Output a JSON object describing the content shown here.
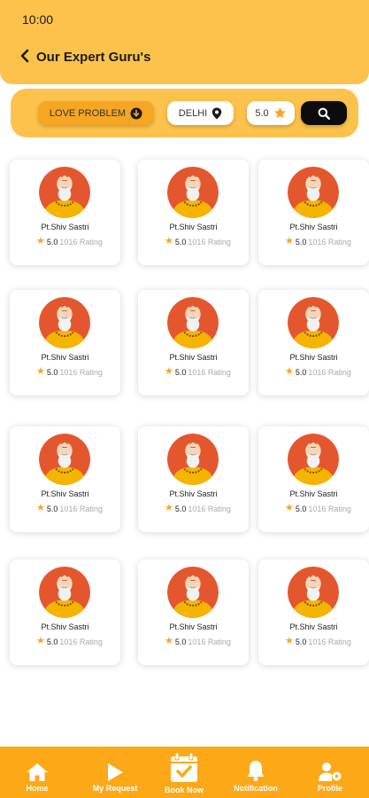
{
  "status_bar": {
    "time": "10:00"
  },
  "header": {
    "title": "Our Expert Guru's"
  },
  "filters": {
    "category": "LOVE PROBLEM",
    "location": "DELHI",
    "rating": "5.0"
  },
  "gurus": [
    {
      "name": "Pt.Shiv Sastri",
      "rating": "5.0",
      "rating_count": "1016 Rating"
    },
    {
      "name": "Pt.Shiv Sastri",
      "rating": "5.0",
      "rating_count": "1016 Rating"
    },
    {
      "name": "Pt.Shiv Sastri",
      "rating": "5.0",
      "rating_count": "1016 Rating"
    },
    {
      "name": "Pt.Shiv Sastri",
      "rating": "5.0",
      "rating_count": "1016 Rating"
    },
    {
      "name": "Pt.Shiv Sastri",
      "rating": "5.0",
      "rating_count": "1016 Rating"
    },
    {
      "name": "Pt.Shiv Sastri",
      "rating": "5.0",
      "rating_count": "1016 Rating"
    },
    {
      "name": "Pt.Shiv Sastri",
      "rating": "5.0",
      "rating_count": "1016 Rating"
    },
    {
      "name": "Pt.Shiv Sastri",
      "rating": "5.0",
      "rating_count": "1016 Rating"
    },
    {
      "name": "Pt.Shiv Sastri",
      "rating": "5.0",
      "rating_count": "1016 Rating"
    },
    {
      "name": "Pt.Shiv Sastri",
      "rating": "5.0",
      "rating_count": "1016 Rating"
    },
    {
      "name": "Pt.Shiv Sastri",
      "rating": "5.0",
      "rating_count": "1016 Rating"
    },
    {
      "name": "Pt.Shiv Sastri",
      "rating": "5.0",
      "rating_count": "1016 Rating"
    }
  ],
  "nav": [
    {
      "label": "Home",
      "icon": "home-icon"
    },
    {
      "label": "My Request",
      "icon": "play-icon"
    },
    {
      "label": "Book Now",
      "icon": "calendar-check-icon"
    },
    {
      "label": "Notification",
      "icon": "bell-icon"
    },
    {
      "label": "Profile",
      "icon": "profile-gear-icon"
    }
  ],
  "colors": {
    "header": "#FCC24B",
    "accent": "#F6A623",
    "nav": "#FCA817",
    "avatar_bg": "#E4572E"
  }
}
